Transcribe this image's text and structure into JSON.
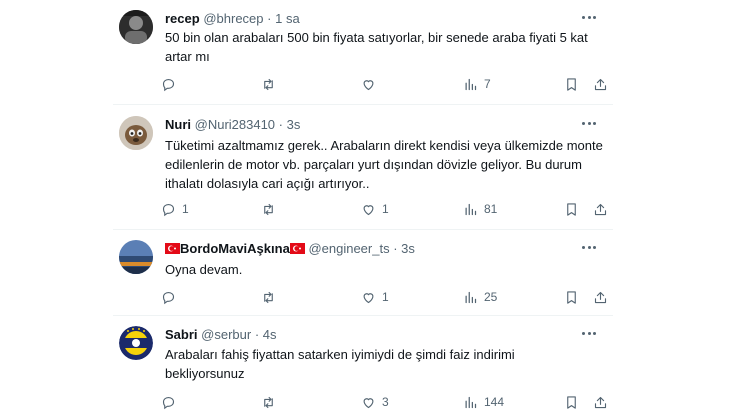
{
  "tweets": [
    {
      "name": "recep",
      "handle": "@bhrecep",
      "sep": "·",
      "time": "1 sa",
      "text": "50 bin olan arabaları 500 bin fiyata satıyorlar, bir senede araba fiyati 5 kat artar mı",
      "replies": "",
      "retweets": "",
      "likes": "",
      "views": "7"
    },
    {
      "name": "Nuri",
      "handle": "@Nuri283410",
      "sep": "·",
      "time": "3s",
      "text": "Tüketimi azaltmamız gerek.. Arabaların direkt kendisi veya ülkemizde monte edilenlerin de motor vb.  parçaları yurt dışından dövizle geliyor.  Bu durum ithalatı dolasıyla cari açığı  artırıyor..",
      "replies": "1",
      "retweets": "",
      "likes": "1",
      "views": "81"
    },
    {
      "name": "BordoMaviAşkına",
      "handle": "@engineer_ts",
      "sep": "·",
      "time": "3s",
      "text": "Oyna devam.",
      "replies": "",
      "retweets": "",
      "likes": "1",
      "views": "25"
    },
    {
      "name": "Sabri",
      "handle": "@serbur",
      "sep": "·",
      "time": "4s",
      "text": "Arabaları fahiş fiyattan satarken iyimiydi de şimdi faiz indirimi bekliyorsunuz",
      "replies": "",
      "retweets": "",
      "likes": "3",
      "views": "144"
    }
  ],
  "colors": {
    "text": "#0f1419",
    "muted": "#536471",
    "divider": "#eff3f4",
    "flag_red": "#e30a17"
  },
  "icons": [
    "reply-icon",
    "retweet-icon",
    "like-icon",
    "views-icon",
    "bookmark-icon",
    "share-icon",
    "more-icon",
    "turkey-flag-icon"
  ]
}
